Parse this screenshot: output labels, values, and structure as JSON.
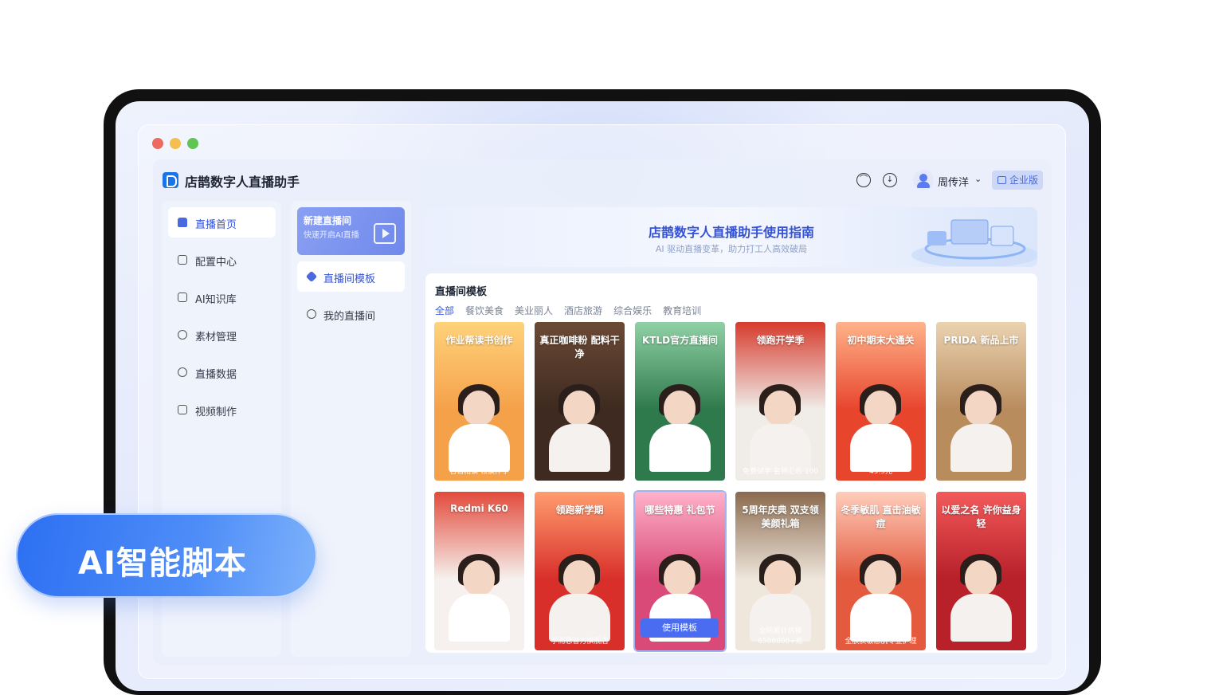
{
  "app": {
    "title": "店鹊数字人直播助手"
  },
  "header": {
    "user_name": "周传洋",
    "enterprise_label": "企业版"
  },
  "sidebar": {
    "items": [
      {
        "label": "直播首页",
        "active": true
      },
      {
        "label": "配置中心"
      },
      {
        "label": "AI知识库"
      },
      {
        "label": "素材管理"
      },
      {
        "label": "直播数据"
      },
      {
        "label": "视频制作"
      }
    ]
  },
  "subpanel": {
    "new_live_title": "新建直播间",
    "new_live_sub": "快速开启AI直播",
    "items": [
      {
        "label": "直播间模板",
        "active": true
      },
      {
        "label": "我的直播间"
      }
    ]
  },
  "guide": {
    "title": "店鹊数字人直播助手使用指南",
    "subtitle": "AI 驱动直播变革，助力打工人高效破局"
  },
  "templates": {
    "section_title": "直播间模板",
    "categories": [
      "全部",
      "餐饮美食",
      "美业丽人",
      "酒店旅游",
      "综合娱乐",
      "教育培训"
    ],
    "use_button": "使用模板",
    "cards": [
      {
        "title": "作业帮读书创作",
        "bottom": "名著精读 领读伴学",
        "bg": "#f5a14a",
        "accent": "#ffd27a"
      },
      {
        "title": "真正咖啡粉 配料干净",
        "bottom": "",
        "bg": "#3e2a20",
        "accent": "#6b4a35"
      },
      {
        "title": "KTLD官方直播间",
        "bottom": "",
        "bg": "#2f7a4c",
        "accent": "#8fd1a4"
      },
      {
        "title": "领跑开学季",
        "bottom": "免费试学 名师汇总 100",
        "bg": "#f0ece8",
        "accent": "#d63b2d"
      },
      {
        "title": "初中期末大通关",
        "bottom": "49.9元",
        "bg": "#e8452d",
        "accent": "#ffb38a"
      },
      {
        "title": "PRIDA 新品上市",
        "bottom": "",
        "bg": "#b98c5e",
        "accent": "#ead3b0"
      },
      {
        "title": "Redmi K60",
        "bottom": "",
        "bg": "#f6f1ee",
        "accent": "#e24a3b"
      },
      {
        "title": "领跑新学期",
        "bottom": "学而思官方旗舰店",
        "bg": "#d82f2a",
        "accent": "#ff9d6e"
      },
      {
        "title": "哪些特惠 礼包节",
        "bottom": "",
        "bg": "#d94a78",
        "accent": "#ffb1c9"
      },
      {
        "title": "5周年庆典 双支领美颜礼箱",
        "bottom": "全网累计热销6500000+瓶",
        "bg": "#efe6dc",
        "accent": "#8a6a4e"
      },
      {
        "title": "冬季敏肌 直击油敏痘",
        "bottom": "全肤质敏感肌专业护理",
        "bg": "#e35a3f",
        "accent": "#ffcdbb"
      },
      {
        "title": "以爱之名 许你益身轻",
        "bottom": "",
        "bg": "#b8202a",
        "accent": "#f25a5a"
      }
    ]
  },
  "banner": {
    "label": "AI智能脚本"
  },
  "colors": {
    "accent": "#3552d6",
    "primary_button": "#4a6cf0",
    "window_red": "#ec6a5e",
    "window_yellow": "#f4bf4f",
    "window_green": "#61c554"
  }
}
